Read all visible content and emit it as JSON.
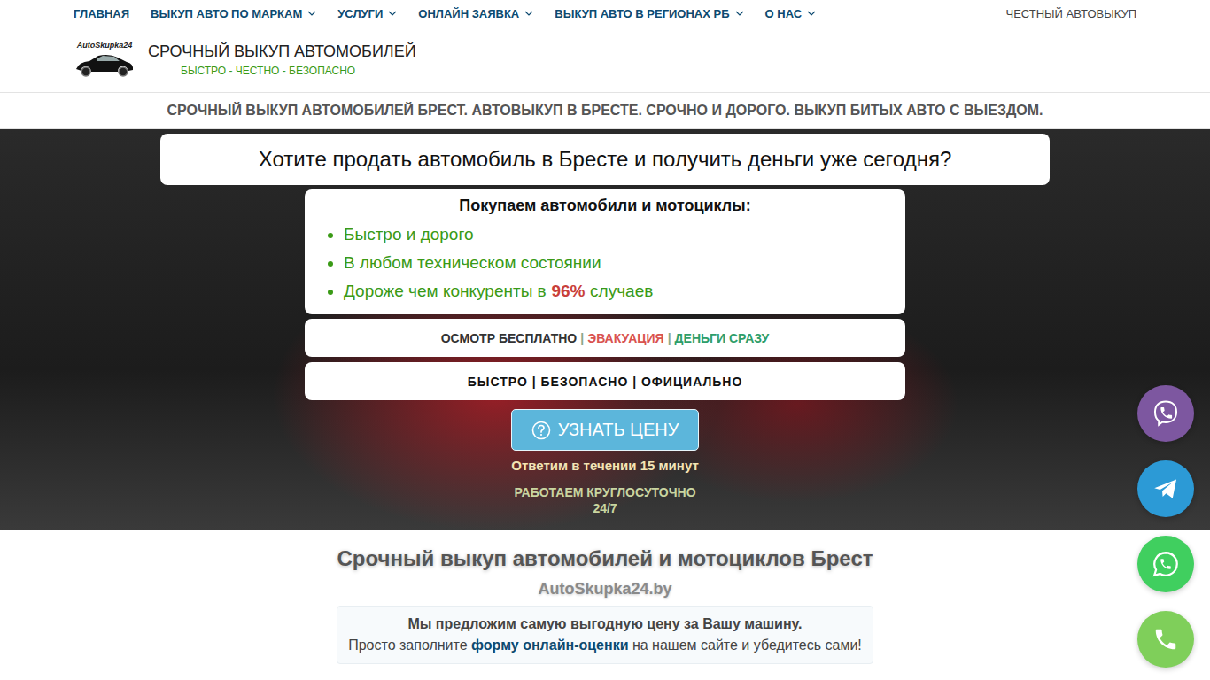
{
  "nav": {
    "items": [
      {
        "label": "ГЛАВНАЯ",
        "dropdown": false
      },
      {
        "label": "ВЫКУП АВТО ПО МАРКАМ",
        "dropdown": true
      },
      {
        "label": "УСЛУГИ",
        "dropdown": true
      },
      {
        "label": "ОНЛАЙН ЗАЯВКА",
        "dropdown": true
      },
      {
        "label": "ВЫКУП АВТО В РЕГИОНАХ РБ",
        "dropdown": true
      },
      {
        "label": "О НАС",
        "dropdown": true
      }
    ],
    "right_label": "ЧЕСТНЫЙ АВТОВЫКУП"
  },
  "header": {
    "logo_text": "AutoSkupka24",
    "title": "СРОЧНЫЙ ВЫКУП АВТОМОБИЛЕЙ",
    "subtitle": "БЫСТРО - ЧЕСТНО - БЕЗОПАСНО"
  },
  "strip": "СРОЧНЫЙ ВЫКУП АВТОМОБИЛЕЙ БРЕСТ. АВТОВЫКУП В БРЕСТЕ. СРОЧНО И ДОРОГО. ВЫКУП БИТЫХ АВТО С ВЫЕЗДОМ.",
  "hero": {
    "headline": "Хотите продать автомобиль в Бресте и получить деньги уже сегодня?",
    "list_title": "Покупаем автомобили и мотоциклы:",
    "features": [
      [
        {
          "text": "Быстро и дорого",
          "emphasis": false
        }
      ],
      [
        {
          "text": "В любом техническом состоянии",
          "emphasis": false
        }
      ],
      [
        {
          "text": "Дороже чем конкуренты в",
          "emphasis": false
        },
        {
          "text": "96%",
          "emphasis": true
        },
        {
          "text": "случаев",
          "emphasis": false
        }
      ]
    ],
    "badges": [
      {
        "text": "ОСМОТР БЕСПЛАТНО",
        "color": "#333333"
      },
      {
        "text": "|",
        "color": "#8aa88a"
      },
      {
        "text": "ЭВАКУАЦИЯ",
        "color": "#d9534f"
      },
      {
        "text": "|",
        "color": "#8aa88a"
      },
      {
        "text": "ДЕНЬГИ СРАЗУ",
        "color": "#2e9e6a"
      }
    ],
    "motto": "БЫСТРО | БЕЗОПАСНО | ОФИЦИАЛЬНО",
    "button": "УЗНАТЬ ЦЕНУ",
    "note": "Ответим в течении 15 минут",
    "hours": [
      "РАБОТАЕМ КРУГЛОСУТОЧНО",
      "24/7"
    ]
  },
  "intro": {
    "heading": "Срочный выкуп автомобилей и мотоциклов Брест",
    "site": "AutoSkupka24.by",
    "line1": "Мы предложим самую выгодную цену за Вашу машину.",
    "before": "Просто заполните",
    "link": "форму онлайн-оценки",
    "after": "на нашем сайте и убедитесь сами!"
  },
  "contacts": [
    {
      "kind": "viber",
      "color": "#7d57a0"
    },
    {
      "kind": "telegram",
      "color": "#2c9ad6"
    },
    {
      "kind": "whatsapp",
      "color": "#40cf5f"
    },
    {
      "kind": "phone",
      "color": "#7fcf5a"
    }
  ]
}
